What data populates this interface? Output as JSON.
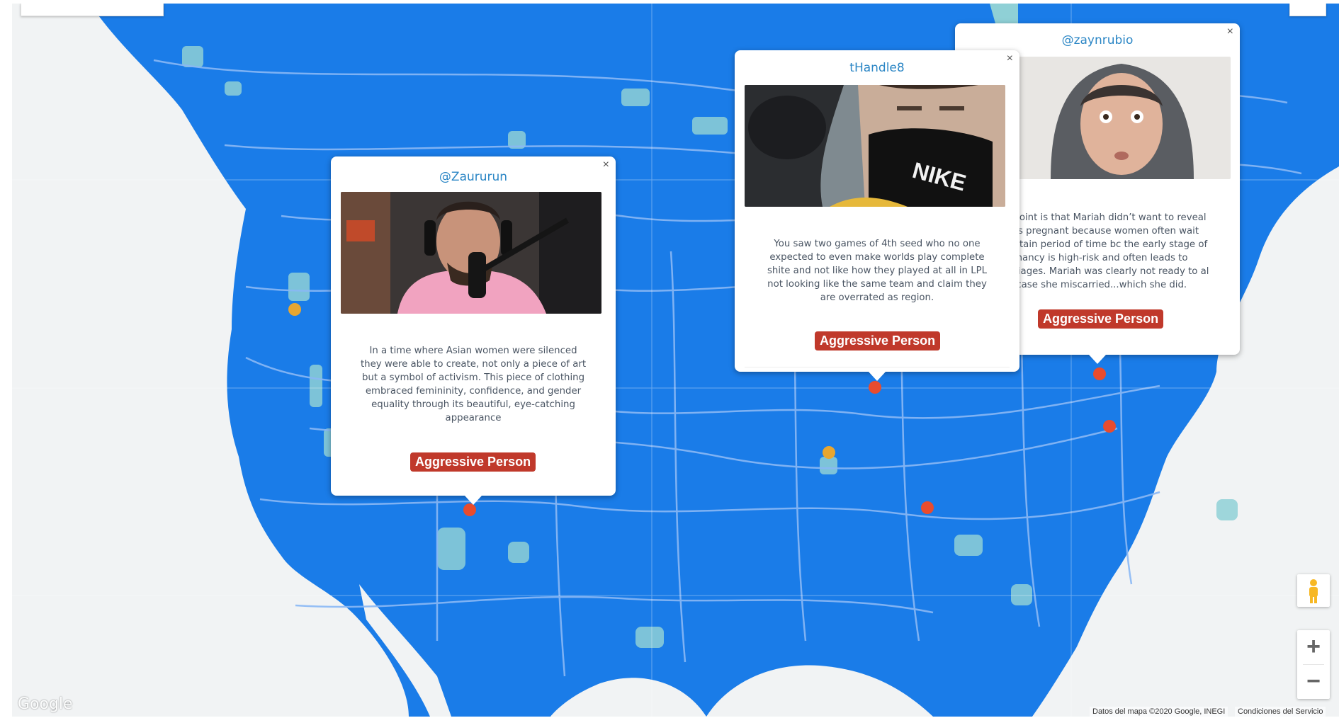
{
  "map": {
    "google_logo": "Google",
    "attribution": "Datos del mapa ©2020 Google, INEGI",
    "terms_link": "Condiciones del Servicio",
    "zoom_in_label": "+",
    "zoom_out_label": "−",
    "water_color": "#1a7ce8",
    "land_color": "#f1f3f4",
    "road_color": "#8ab8f5"
  },
  "popups": [
    {
      "handle": "@Zaururun",
      "close_label": "×",
      "image_desc": "man-with-headphones-photo",
      "caption": "In a time where Asian women were silenced they were able to create, not only a piece of art but a symbol of activism. This piece of clothing embraced femininity, confidence, and gender equality through its beautiful, eye-catching appearance",
      "tag": "Aggressive Person"
    },
    {
      "handle": "tHandle8",
      "close_label": "×",
      "image_desc": "man-in-mask-photo",
      "caption": "You saw two games of 4th seed who no one expected to even make worlds play complete shite and not like how they played at all in LPL not looking like the same team and claim they are overrated as region.",
      "tag": "Aggressive Person"
    },
    {
      "handle": "@zaynrubio",
      "close_label": "×",
      "image_desc": "man-in-hoodie-photo",
      "caption": "e point is that Mariah didn’t want to reveal was pregnant because women often wait certain period of time bc the early stage of egnancy is high-risk and often leads to arriages. Mariah was clearly not ready to al in case she miscarried...which she did.",
      "tag": "Aggressive Person"
    }
  ],
  "markers": [
    {
      "color": "red"
    },
    {
      "color": "red"
    },
    {
      "color": "red"
    },
    {
      "color": "red"
    },
    {
      "color": "red"
    },
    {
      "color": "yellow"
    },
    {
      "color": "yellow"
    }
  ]
}
